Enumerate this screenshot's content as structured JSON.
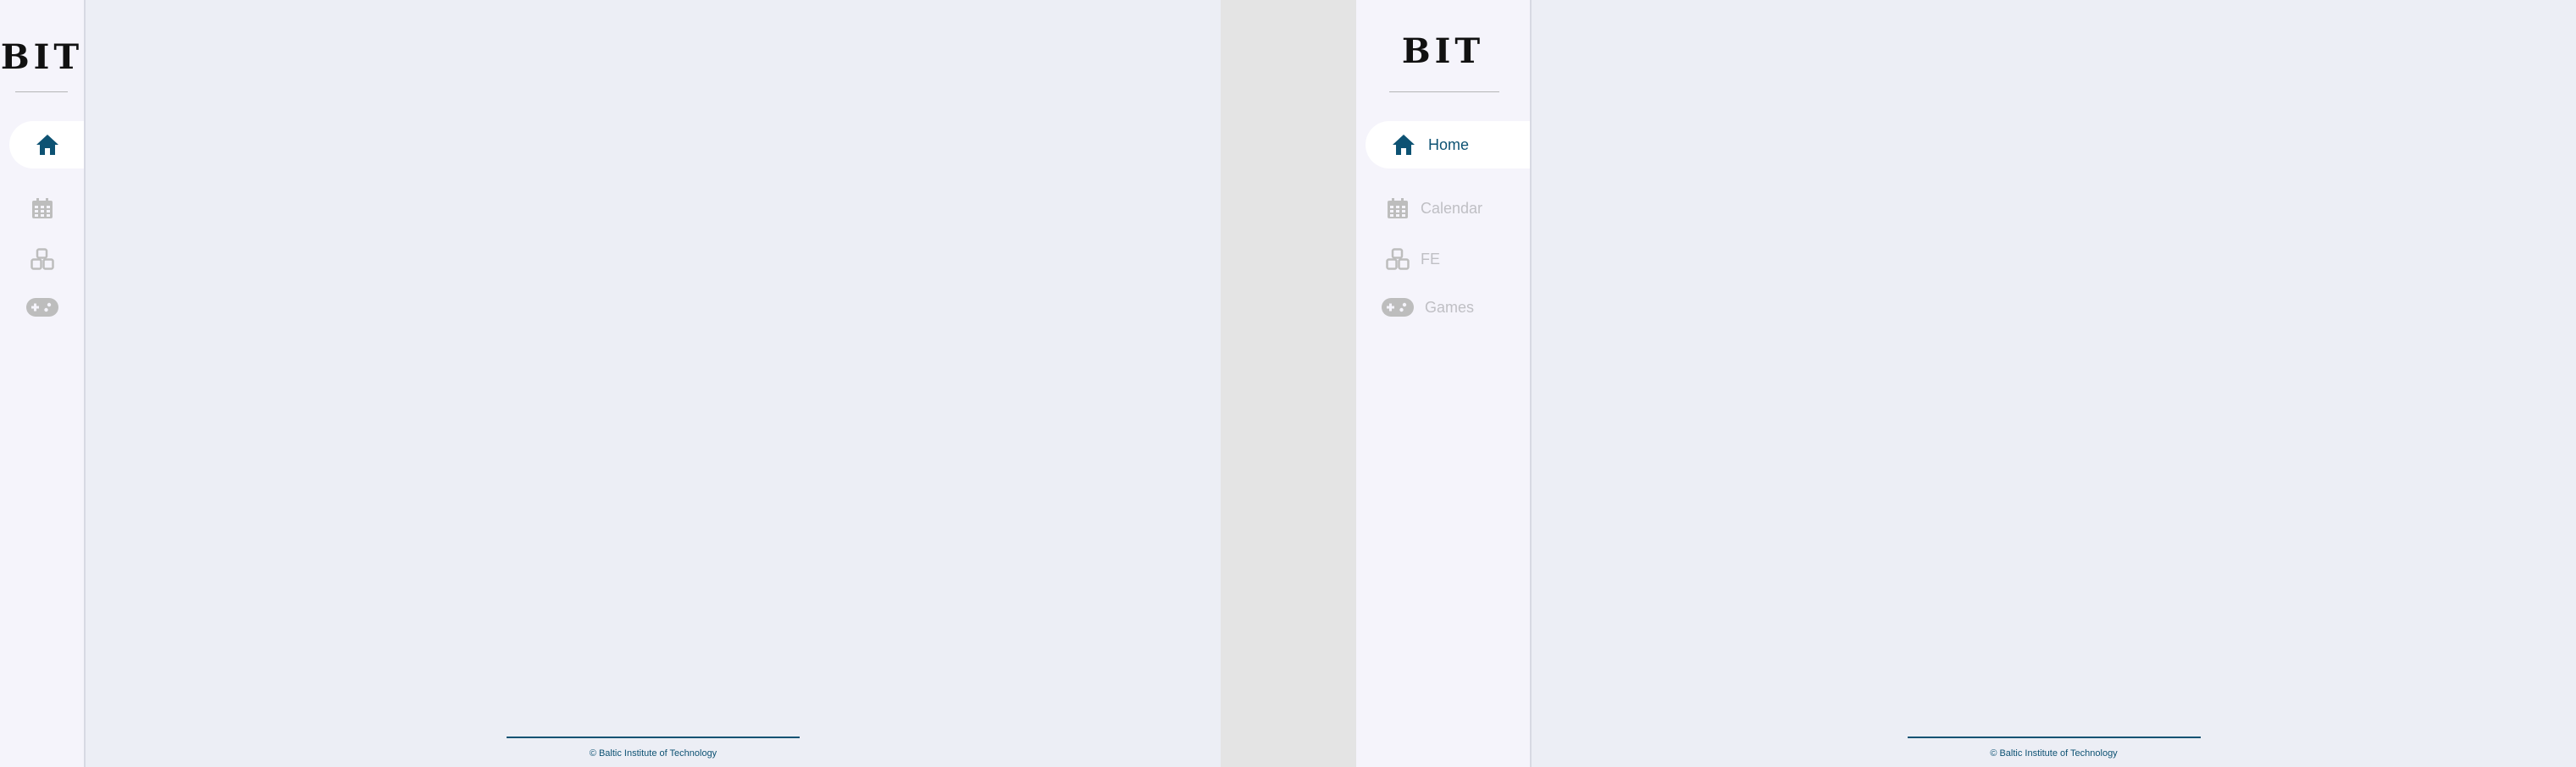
{
  "brand": {
    "logo_text": "BIT"
  },
  "nav": {
    "items": [
      {
        "id": "home",
        "label": "Home",
        "icon": "home-icon",
        "active": true
      },
      {
        "id": "calendar",
        "label": "Calendar",
        "icon": "calendar-icon",
        "active": false
      },
      {
        "id": "fe",
        "label": "FE",
        "icon": "boxes-icon",
        "active": false
      },
      {
        "id": "games",
        "label": "Games",
        "icon": "gamepad-icon",
        "active": false
      }
    ]
  },
  "footer": {
    "copyright": "© Baltic Institute of Technology"
  },
  "colors": {
    "accent": "#0d5273",
    "inactive_icon": "#bdbdbd",
    "sidebar_bg": "#f5f4fb",
    "main_bg": "#eceef5"
  }
}
